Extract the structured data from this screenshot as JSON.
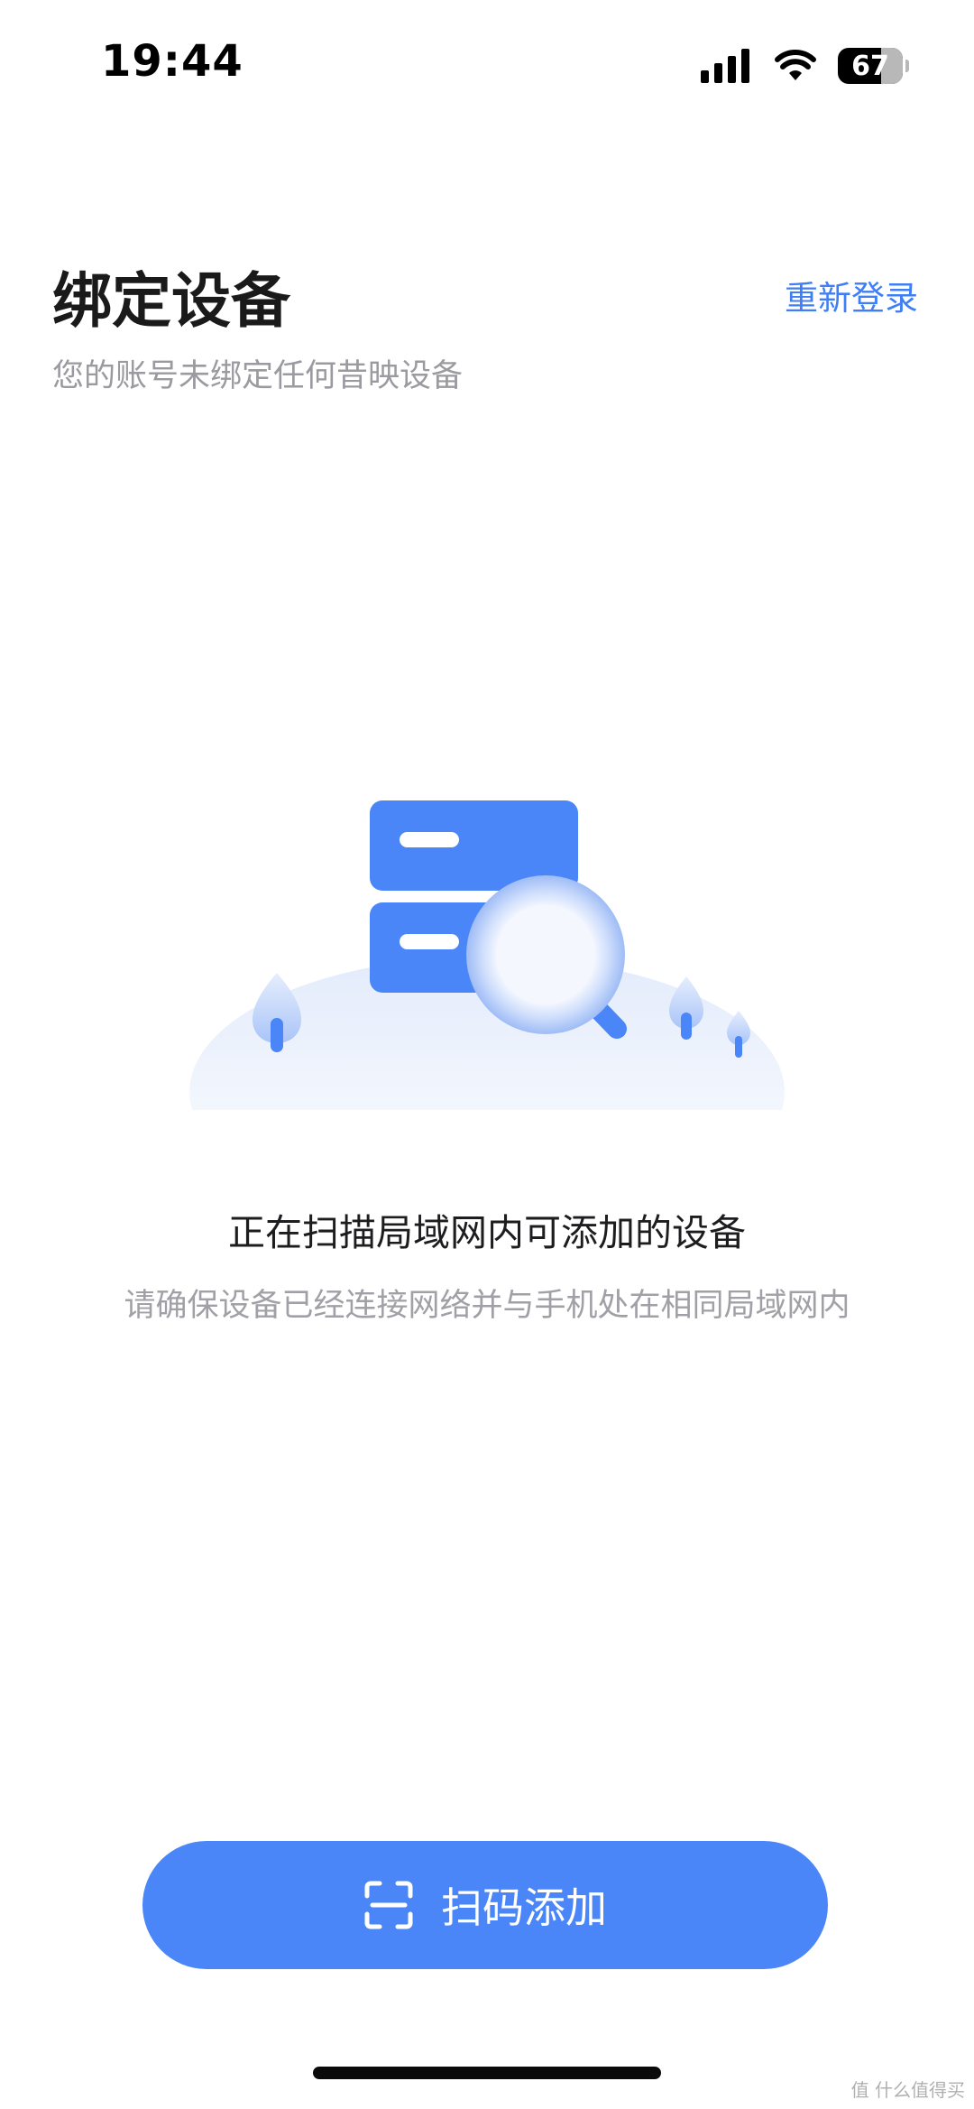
{
  "status_bar": {
    "time": "19:44",
    "battery": "67"
  },
  "header": {
    "title": "绑定设备",
    "relogin_label": "重新登录",
    "subtitle": "您的账号未绑定任何昔映设备"
  },
  "scan": {
    "title": "正在扫描局域网内可添加的设备",
    "hint": "请确保设备已经连接网络并与手机处在相同局域网内"
  },
  "actions": {
    "scan_add_label": "扫码添加"
  },
  "watermark": "值 什么值得买",
  "colors": {
    "accent": "#4a86f7",
    "link": "#3f7ef5"
  },
  "icons": [
    "signal-icon",
    "wifi-icon",
    "battery-icon",
    "qr-scan-icon"
  ]
}
